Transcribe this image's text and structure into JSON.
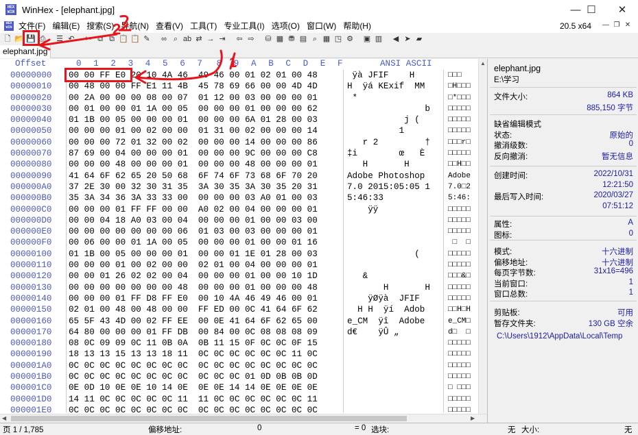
{
  "window": {
    "title": "WinHex - [elephant.jpg]",
    "minimize_glyph": "—",
    "maximize_glyph": "☐",
    "close_glyph": "✕"
  },
  "app_icon_text": "HEX\nWIN",
  "menu": {
    "items": [
      "文件(F)",
      "编辑(E)",
      "搜索(S)",
      "导航(N)",
      "查看(V)",
      "工具(T)",
      "专业工具(I)",
      "选项(O)",
      "窗口(W)",
      "帮助(H)"
    ],
    "version": "20.5 x64"
  },
  "toolbar": {
    "icons": [
      "new-file-icon",
      "open-file-icon",
      "save-icon",
      "print-icon",
      "properties-icon",
      "undo-icon",
      "cut-icon",
      "copy-icon",
      "copy-block-icon",
      "paste-icon",
      "paste-write-icon",
      "write-icon",
      "binoculars-icon",
      "find-hex-icon",
      "replace-text-icon",
      "replace-hex-icon",
      "goto-icon",
      "goto-offset-icon",
      "back-icon",
      "forward-icon",
      "disk-icon",
      "ram-icon",
      "drive-icon",
      "calculator-icon",
      "search-icon",
      "table-icon",
      "snapshot-icon",
      "gear-icon",
      "screenshot-icon",
      "grid-icon",
      "arrow-left-icon",
      "cursor-icon",
      "book-icon"
    ]
  },
  "tab": {
    "label": "elephant.jpg"
  },
  "hexview": {
    "offset_header": "Offset",
    "column_headers": [
      "0",
      "1",
      "2",
      "3",
      "4",
      "5",
      "6",
      "7",
      "8",
      "9",
      "A",
      "B",
      "C",
      "D",
      "E",
      "F"
    ],
    "ascii_header": "ANSI ASCII",
    "rows": [
      {
        "addr": "00000000",
        "hex": "00 00 FF E0 20 10 4A 46  49 46 00 01 02 01 00 48",
        "ascii": " ÿà JFIF    H",
        "text2": "□□□"
      },
      {
        "addr": "00000010",
        "hex": "00 48 00 00 FF E1 11 4B  45 78 69 66 00 00 4D 4D",
        "ascii": "H  ÿá KExif  MM",
        "text2": "□H□□□"
      },
      {
        "addr": "00000020",
        "hex": "00 2A 00 00 00 08 00 07  01 12 00 03 00 00 00 01",
        "ascii": " *",
        "text2": "□*□□□"
      },
      {
        "addr": "00000030",
        "hex": "00 01 00 00 01 1A 00 05  00 00 00 01 00 00 00 62",
        "ascii": "               b",
        "text2": "□□□□□"
      },
      {
        "addr": "00000040",
        "hex": "01 1B 00 05 00 00 00 01  00 00 00 6A 01 28 00 03",
        "ascii": "           j (",
        "text2": "□□□□□"
      },
      {
        "addr": "00000050",
        "hex": "00 00 00 01 00 02 00 00  01 31 00 02 00 00 00 14",
        "ascii": "          1",
        "text2": "□□□□□"
      },
      {
        "addr": "00000060",
        "hex": "00 00 00 72 01 32 00 02  00 00 00 14 00 00 00 86",
        "ascii": "   r 2         †",
        "text2": "□□□r□"
      },
      {
        "addr": "00000070",
        "hex": "87 69 00 04 00 00 00 01  00 00 00 9C 00 00 00 C8",
        "ascii": "‡i        œ   È",
        "text2": "□□□□□"
      },
      {
        "addr": "00000080",
        "hex": "00 00 00 48 00 00 00 01  00 00 00 48 00 00 00 01",
        "ascii": "   H       H",
        "text2": "□□H□□"
      },
      {
        "addr": "00000090",
        "hex": "41 64 6F 62 65 20 50 68  6F 74 6F 73 68 6F 70 20",
        "ascii": "Adobe Photoshop ",
        "text2": "Adobe"
      },
      {
        "addr": "000000A0",
        "hex": "37 2E 30 00 32 30 31 35  3A 30 35 3A 30 35 20 31",
        "ascii": "7.0 2015:05:05 1",
        "text2": "7.0□2"
      },
      {
        "addr": "000000B0",
        "hex": "35 3A 34 36 3A 33 33 00  00 00 00 03 A0 01 00 03",
        "ascii": "5:46:33",
        "text2": "5:46:"
      },
      {
        "addr": "000000C0",
        "hex": "00 00 00 01 FF FF 00 00  A0 02 00 04 00 00 00 01",
        "ascii": "    ÿÿ",
        "text2": "□□□□□"
      },
      {
        "addr": "000000D0",
        "hex": "00 00 04 18 A0 03 00 04  00 00 00 01 00 00 03 00",
        "ascii": "",
        "text2": "□□□□□"
      },
      {
        "addr": "000000E0",
        "hex": "00 00 00 00 00 00 00 06  01 03 00 03 00 00 00 01",
        "ascii": "",
        "text2": "□□□□□"
      },
      {
        "addr": "000000F0",
        "hex": "00 06 00 00 01 1A 00 05  00 00 00 01 00 00 01 16",
        "ascii": "",
        "text2": " □  □"
      },
      {
        "addr": "00000100",
        "hex": "01 1B 00 05 00 00 00 01  00 00 01 1E 01 28 00 03",
        "ascii": "             (",
        "text2": "□□□□□"
      },
      {
        "addr": "00000110",
        "hex": "00 00 00 01 00 02 00 00  02 01 00 04 00 00 00 01",
        "ascii": "",
        "text2": "□□□□□"
      },
      {
        "addr": "00000120",
        "hex": "00 00 01 26 02 02 00 04  00 00 00 01 00 00 10 1D",
        "ascii": "   &",
        "text2": "□□□&□"
      },
      {
        "addr": "00000130",
        "hex": "00 00 00 00 00 00 00 48  00 00 00 01 00 00 00 48",
        "ascii": "       H       H",
        "text2": "□□□□□"
      },
      {
        "addr": "00000140",
        "hex": "00 00 00 01 FF D8 FF E0  00 10 4A 46 49 46 00 01",
        "ascii": "    ÿØÿà  JFIF",
        "text2": "□□□□□"
      },
      {
        "addr": "00000150",
        "hex": "02 01 00 48 00 48 00 00  FF ED 00 0C 41 64 6F 62",
        "ascii": "  H H  ÿí  Adob",
        "text2": "□□H□H"
      },
      {
        "addr": "00000160",
        "hex": "65 5F 43 4D 00 02 FF EE  00 0E 41 64 6F 62 65 00",
        "ascii": "e_CM  ÿî  Adobe",
        "text2": "e_CM□"
      },
      {
        "addr": "00000170",
        "hex": "64 80 00 00 00 01 FF DB  00 84 00 0C 08 08 08 09",
        "ascii": "d€    ÿÛ „",
        "text2": "d□  □"
      },
      {
        "addr": "00000180",
        "hex": "08 0C 09 09 0C 11 0B 0A  0B 11 15 0F 0C 0C 0F 15",
        "ascii": "",
        "text2": "□□□□□"
      },
      {
        "addr": "00000190",
        "hex": "18 13 13 15 13 13 18 11  0C 0C 0C 0C 0C 0C 11 0C",
        "ascii": "",
        "text2": "□□□□□"
      },
      {
        "addr": "000001A0",
        "hex": "0C 0C 0C 0C 0C 0C 0C 0C  0C 0C 0C 0C 0C 0C 0C 0C",
        "ascii": "",
        "text2": "□□□□□"
      },
      {
        "addr": "000001B0",
        "hex": "0C 0C 0C 0C 0C 0C 0C 0C  0C 0C 0C 01 0D 0B 0B 0D",
        "ascii": "",
        "text2": "□□□□□"
      },
      {
        "addr": "000001C0",
        "hex": "0E 0D 10 0E 0E 10 14 0E  0E 0E 14 14 0E 0E 0E 0E",
        "ascii": "",
        "text2": "□ □□□"
      },
      {
        "addr": "000001D0",
        "hex": "14 11 0C 0C 0C 0C 0C 11  11 0C 0C 0C 0C 0C 0C 11",
        "ascii": "",
        "text2": "□□□□□"
      },
      {
        "addr": "000001E0",
        "hex": "0C 0C 0C 0C 0C 0C 0C 0C  0C 0C 0C 0C 0C 0C 0C 0C",
        "ascii": "",
        "text2": "□□□□□"
      }
    ]
  },
  "info_panel": {
    "filename": "elephant.jpg",
    "path": "E:\\学习",
    "rows_a": [
      {
        "k": "文件大小:",
        "v": "864 KB"
      },
      {
        "k": "",
        "v": "885,150 字节"
      }
    ],
    "rows_b": [
      {
        "k": "缺省编辑模式",
        "v": ""
      },
      {
        "k": "状态:",
        "v": "原始的"
      },
      {
        "k": "撤消级数:",
        "v": "0"
      },
      {
        "k": "反向撤消:",
        "v": "暂无信息"
      }
    ],
    "rows_c": [
      {
        "k": "创建时间:",
        "v": "2022/10/31"
      },
      {
        "k": "",
        "v": "12:21:50"
      },
      {
        "k": "最后写入时间:",
        "v": "2020/03/27"
      },
      {
        "k": "",
        "v": "07:51:12"
      }
    ],
    "rows_d": [
      {
        "k": "属性:",
        "v": "A"
      },
      {
        "k": "图标:",
        "v": "0"
      }
    ],
    "rows_e": [
      {
        "k": "模式:",
        "v": "十六进制"
      },
      {
        "k": "偏移地址:",
        "v": "十六进制"
      },
      {
        "k": "每页字节数:",
        "v": "31x16=496"
      },
      {
        "k": "当前窗口:",
        "v": "1"
      },
      {
        "k": "窗口总数:",
        "v": "1"
      }
    ],
    "rows_f": [
      {
        "k": "剪贴板:",
        "v": "可用"
      },
      {
        "k": "暂存文件夹:",
        "v": "130 GB 空余"
      }
    ],
    "temp_path": "C:\\Users\\1912\\AppData\\Local\\Temp"
  },
  "statusbar": {
    "page": "页 1 / 1,785",
    "offset_label": "偏移地址:",
    "offset_value": "0",
    "eq": "= 0",
    "select_label": "选块:",
    "none": "无",
    "size_label": "大小:",
    "none2": "无"
  },
  "annotations": {
    "label_1": "1",
    "label_2": "2"
  },
  "colors": {
    "annotation_red": "#e8141c",
    "offset_blue": "#4a58c8",
    "value_blue": "#1a1aa8"
  }
}
